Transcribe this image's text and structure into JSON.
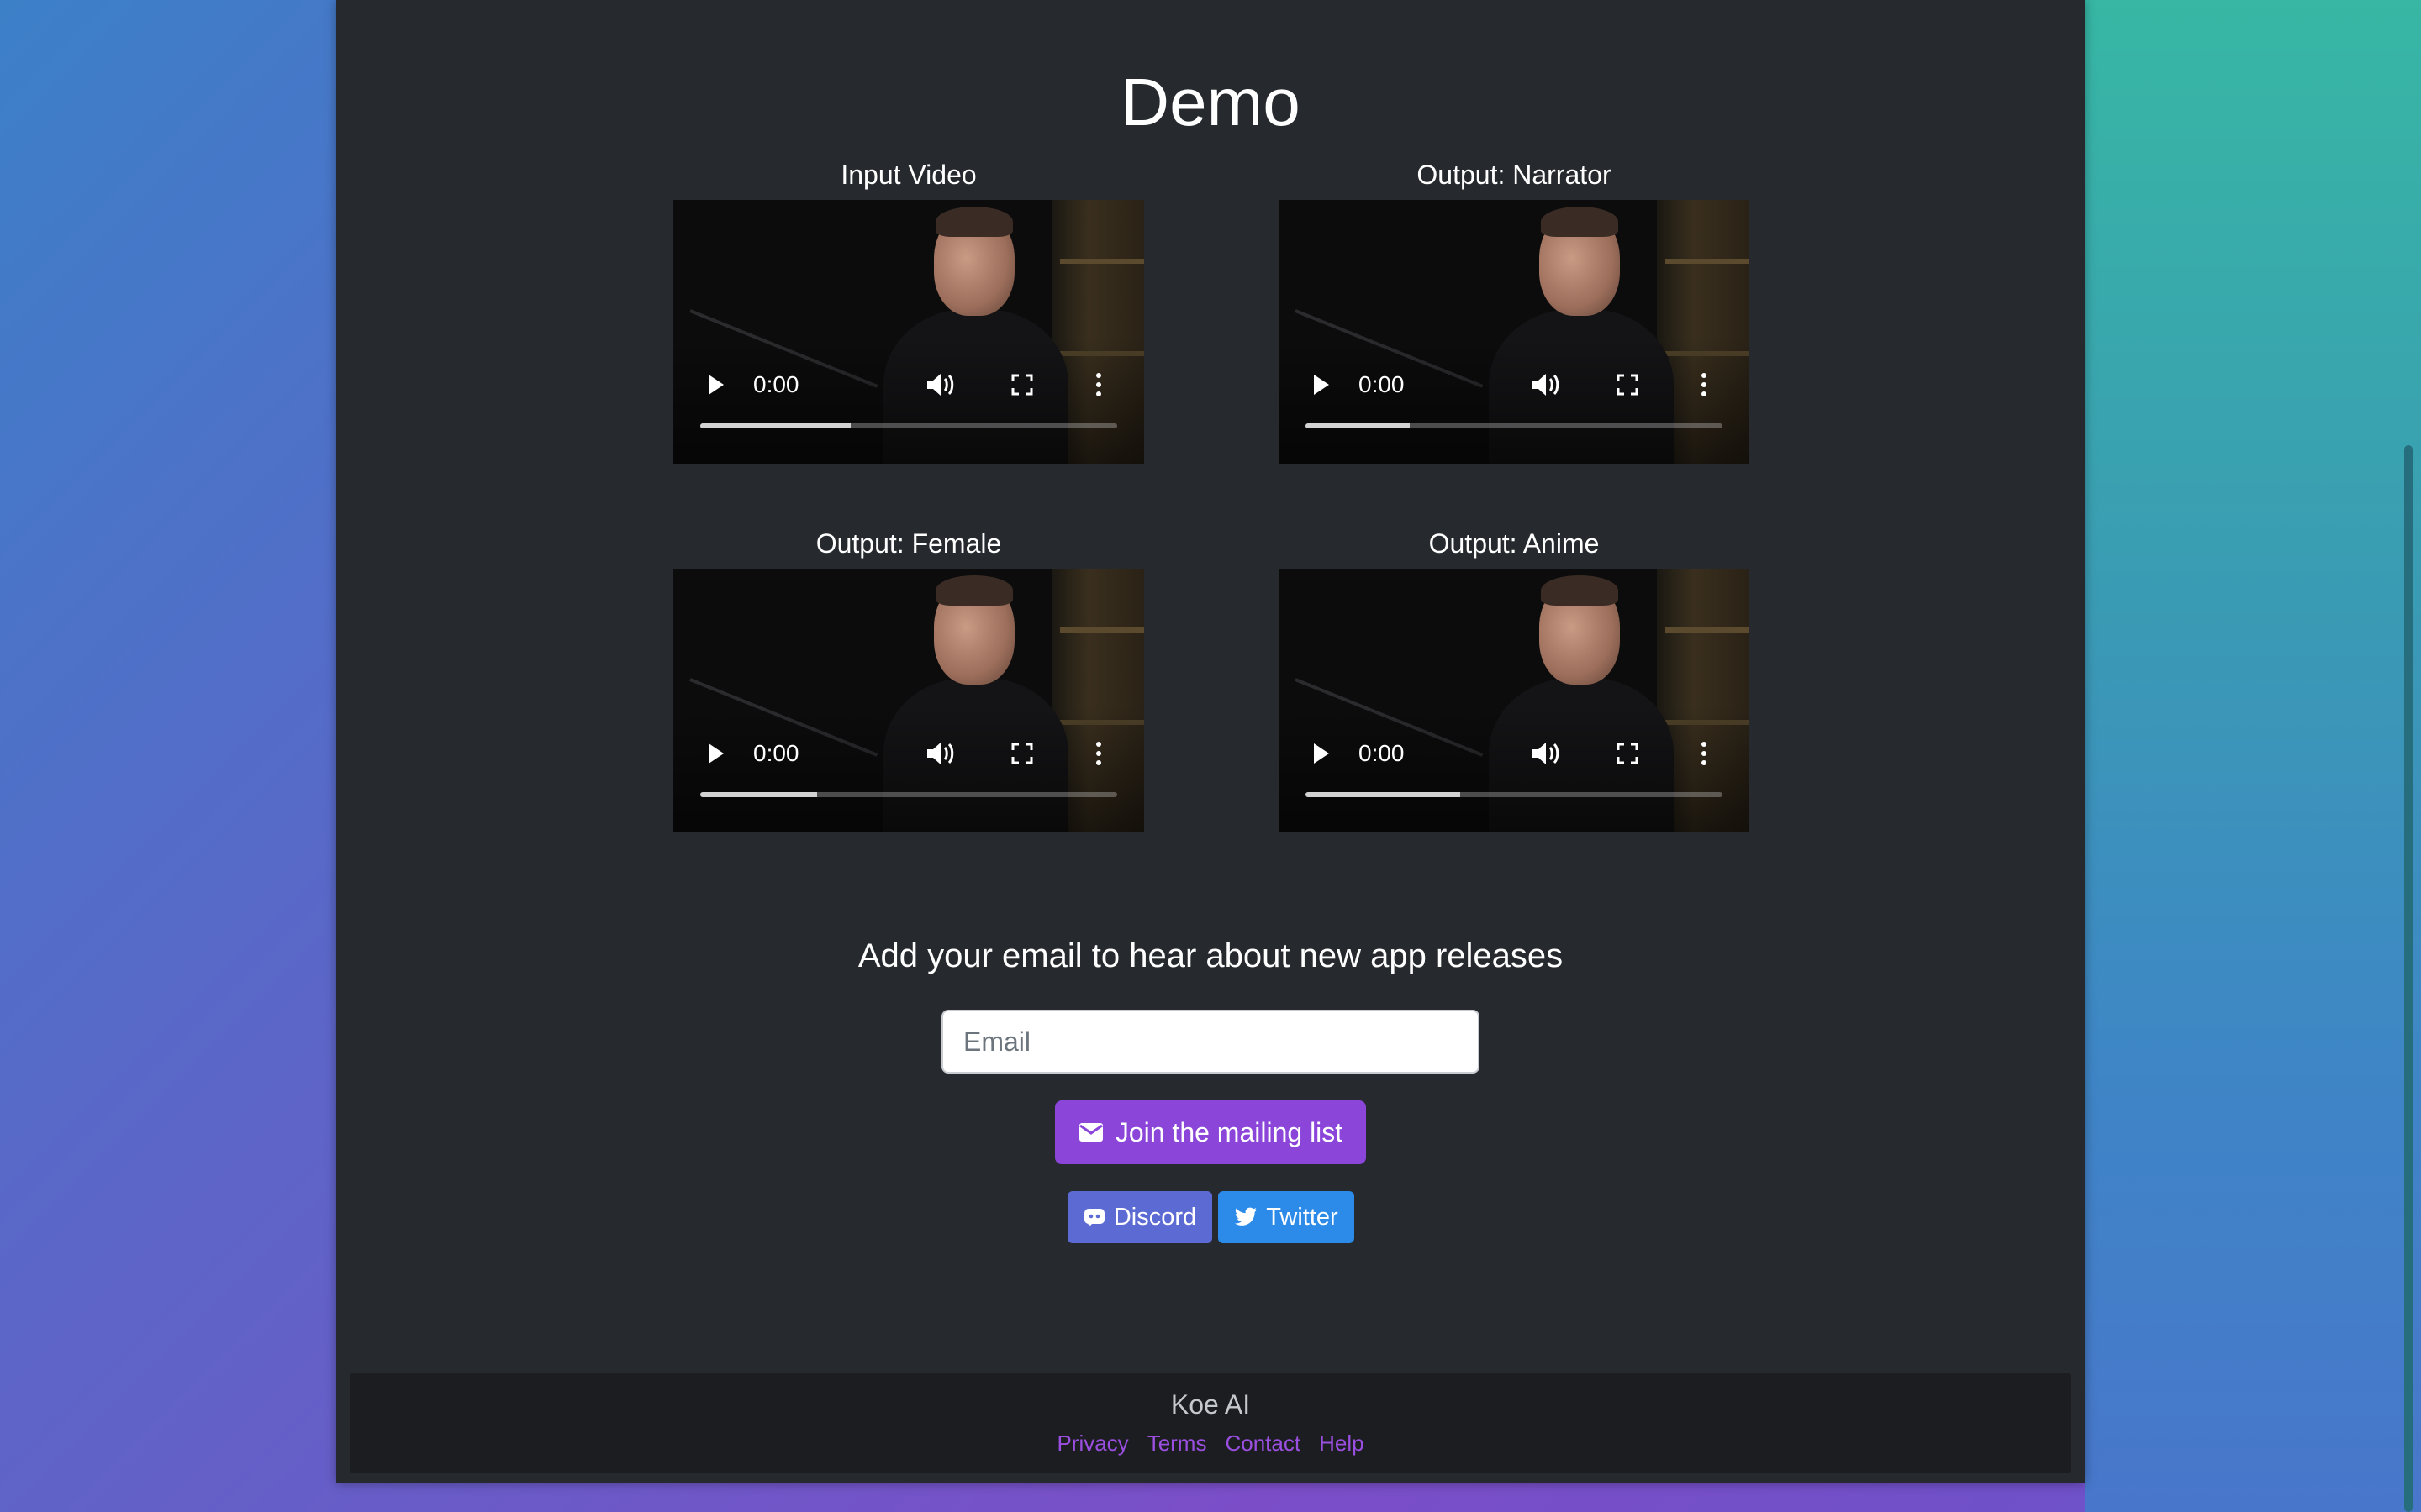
{
  "demo": {
    "title": "Demo",
    "videos": [
      {
        "label": "Input Video",
        "time": "0:00",
        "buffered_fraction": 0.36
      },
      {
        "label": "Output: Narrator",
        "time": "0:00",
        "buffered_fraction": 0.25
      },
      {
        "label": "Output: Female",
        "time": "0:00",
        "buffered_fraction": 0.28
      },
      {
        "label": "Output: Anime",
        "time": "0:00",
        "buffered_fraction": 0.37
      }
    ]
  },
  "signup": {
    "heading": "Add your email to hear about new app releases",
    "email_placeholder": "Email",
    "join_label": "Join the mailing list",
    "join_icon": "envelope-icon"
  },
  "social": {
    "discord_label": "Discord",
    "discord_icon": "discord-icon",
    "twitter_label": "Twitter",
    "twitter_icon": "twitter-bird-icon"
  },
  "footer": {
    "brand": "Koe AI",
    "links": [
      "Privacy",
      "Terms",
      "Contact",
      "Help"
    ]
  },
  "colors": {
    "panel": "#262a2e",
    "accent_purple": "#8b45d9",
    "discord_blue": "#5c6bd4",
    "twitter_blue": "#2c8ae8",
    "footer_link": "#9a4fe0"
  }
}
